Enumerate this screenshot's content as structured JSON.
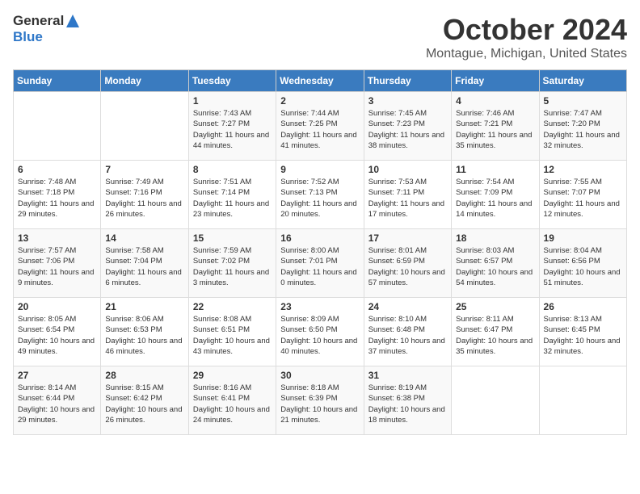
{
  "header": {
    "logo_general": "General",
    "logo_blue": "Blue",
    "title": "October 2024",
    "subtitle": "Montague, Michigan, United States"
  },
  "weekdays": [
    "Sunday",
    "Monday",
    "Tuesday",
    "Wednesday",
    "Thursday",
    "Friday",
    "Saturday"
  ],
  "weeks": [
    [
      {
        "num": "",
        "info": ""
      },
      {
        "num": "",
        "info": ""
      },
      {
        "num": "1",
        "info": "Sunrise: 7:43 AM\nSunset: 7:27 PM\nDaylight: 11 hours and 44 minutes."
      },
      {
        "num": "2",
        "info": "Sunrise: 7:44 AM\nSunset: 7:25 PM\nDaylight: 11 hours and 41 minutes."
      },
      {
        "num": "3",
        "info": "Sunrise: 7:45 AM\nSunset: 7:23 PM\nDaylight: 11 hours and 38 minutes."
      },
      {
        "num": "4",
        "info": "Sunrise: 7:46 AM\nSunset: 7:21 PM\nDaylight: 11 hours and 35 minutes."
      },
      {
        "num": "5",
        "info": "Sunrise: 7:47 AM\nSunset: 7:20 PM\nDaylight: 11 hours and 32 minutes."
      }
    ],
    [
      {
        "num": "6",
        "info": "Sunrise: 7:48 AM\nSunset: 7:18 PM\nDaylight: 11 hours and 29 minutes."
      },
      {
        "num": "7",
        "info": "Sunrise: 7:49 AM\nSunset: 7:16 PM\nDaylight: 11 hours and 26 minutes."
      },
      {
        "num": "8",
        "info": "Sunrise: 7:51 AM\nSunset: 7:14 PM\nDaylight: 11 hours and 23 minutes."
      },
      {
        "num": "9",
        "info": "Sunrise: 7:52 AM\nSunset: 7:13 PM\nDaylight: 11 hours and 20 minutes."
      },
      {
        "num": "10",
        "info": "Sunrise: 7:53 AM\nSunset: 7:11 PM\nDaylight: 11 hours and 17 minutes."
      },
      {
        "num": "11",
        "info": "Sunrise: 7:54 AM\nSunset: 7:09 PM\nDaylight: 11 hours and 14 minutes."
      },
      {
        "num": "12",
        "info": "Sunrise: 7:55 AM\nSunset: 7:07 PM\nDaylight: 11 hours and 12 minutes."
      }
    ],
    [
      {
        "num": "13",
        "info": "Sunrise: 7:57 AM\nSunset: 7:06 PM\nDaylight: 11 hours and 9 minutes."
      },
      {
        "num": "14",
        "info": "Sunrise: 7:58 AM\nSunset: 7:04 PM\nDaylight: 11 hours and 6 minutes."
      },
      {
        "num": "15",
        "info": "Sunrise: 7:59 AM\nSunset: 7:02 PM\nDaylight: 11 hours and 3 minutes."
      },
      {
        "num": "16",
        "info": "Sunrise: 8:00 AM\nSunset: 7:01 PM\nDaylight: 11 hours and 0 minutes."
      },
      {
        "num": "17",
        "info": "Sunrise: 8:01 AM\nSunset: 6:59 PM\nDaylight: 10 hours and 57 minutes."
      },
      {
        "num": "18",
        "info": "Sunrise: 8:03 AM\nSunset: 6:57 PM\nDaylight: 10 hours and 54 minutes."
      },
      {
        "num": "19",
        "info": "Sunrise: 8:04 AM\nSunset: 6:56 PM\nDaylight: 10 hours and 51 minutes."
      }
    ],
    [
      {
        "num": "20",
        "info": "Sunrise: 8:05 AM\nSunset: 6:54 PM\nDaylight: 10 hours and 49 minutes."
      },
      {
        "num": "21",
        "info": "Sunrise: 8:06 AM\nSunset: 6:53 PM\nDaylight: 10 hours and 46 minutes."
      },
      {
        "num": "22",
        "info": "Sunrise: 8:08 AM\nSunset: 6:51 PM\nDaylight: 10 hours and 43 minutes."
      },
      {
        "num": "23",
        "info": "Sunrise: 8:09 AM\nSunset: 6:50 PM\nDaylight: 10 hours and 40 minutes."
      },
      {
        "num": "24",
        "info": "Sunrise: 8:10 AM\nSunset: 6:48 PM\nDaylight: 10 hours and 37 minutes."
      },
      {
        "num": "25",
        "info": "Sunrise: 8:11 AM\nSunset: 6:47 PM\nDaylight: 10 hours and 35 minutes."
      },
      {
        "num": "26",
        "info": "Sunrise: 8:13 AM\nSunset: 6:45 PM\nDaylight: 10 hours and 32 minutes."
      }
    ],
    [
      {
        "num": "27",
        "info": "Sunrise: 8:14 AM\nSunset: 6:44 PM\nDaylight: 10 hours and 29 minutes."
      },
      {
        "num": "28",
        "info": "Sunrise: 8:15 AM\nSunset: 6:42 PM\nDaylight: 10 hours and 26 minutes."
      },
      {
        "num": "29",
        "info": "Sunrise: 8:16 AM\nSunset: 6:41 PM\nDaylight: 10 hours and 24 minutes."
      },
      {
        "num": "30",
        "info": "Sunrise: 8:18 AM\nSunset: 6:39 PM\nDaylight: 10 hours and 21 minutes."
      },
      {
        "num": "31",
        "info": "Sunrise: 8:19 AM\nSunset: 6:38 PM\nDaylight: 10 hours and 18 minutes."
      },
      {
        "num": "",
        "info": ""
      },
      {
        "num": "",
        "info": ""
      }
    ]
  ]
}
